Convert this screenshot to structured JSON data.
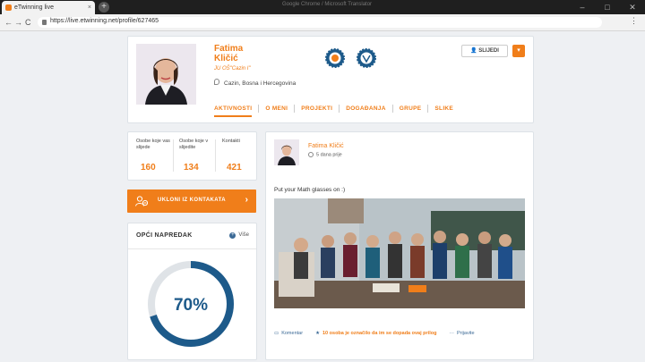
{
  "browser": {
    "tab_title": "eTwinning live",
    "tab_close": "×",
    "new_tab": "+",
    "window_title": "Google Chrome / Microsoft Translator",
    "minimize": "–",
    "maximize": "□",
    "close": "✕",
    "url": "https://live.etwinning.net/profile/627465",
    "back": "←",
    "forward": "→",
    "reload": "C",
    "menu": "⋮"
  },
  "profile": {
    "first_name": "Fatima",
    "last_name": "Kličić",
    "school": "JU OŠ\"Cazin I\"",
    "location": "Cazin, Bosna i Hercegovina",
    "follow_label": "SLIJEDI",
    "follow_icon": "person-plus-icon",
    "dropdown_glyph": "▾",
    "tabs": [
      {
        "label": "AKTIVNOSTI",
        "active": true
      },
      {
        "label": "O MENI",
        "active": false
      },
      {
        "label": "PROJEKTI",
        "active": false
      },
      {
        "label": "DOGAĐANJA",
        "active": false
      },
      {
        "label": "GRUPE",
        "active": false
      },
      {
        "label": "SLIKE",
        "active": false
      }
    ]
  },
  "stats": [
    {
      "label": "Osobe koje vas slijede",
      "value": "160"
    },
    {
      "label": "Osobe koje v slijedite",
      "value": "134"
    },
    {
      "label": "Kontakti",
      "value": "421"
    }
  ],
  "remove_contact": {
    "label": "UKLONI IZ KONTAKATA",
    "arrow": "›",
    "icon": "remove-contact-icon"
  },
  "progress": {
    "title": "OPĆI NAPREDAK",
    "more_label": "Više",
    "more_plus": "+",
    "percent": 70,
    "percent_label": "70%"
  },
  "post": {
    "author": "Fatima Kličić",
    "time": "5 dana prije",
    "text": "Put your Math glasses on :)",
    "comment_label": "Komentar",
    "likes_label": "10 osoba je označilo da im se dopada ovaj prilog",
    "report_label": "Prijavite"
  },
  "colors": {
    "accent": "#f07e1a",
    "ring": "#1d5a8a",
    "ring_track": "#dfe3e7"
  }
}
